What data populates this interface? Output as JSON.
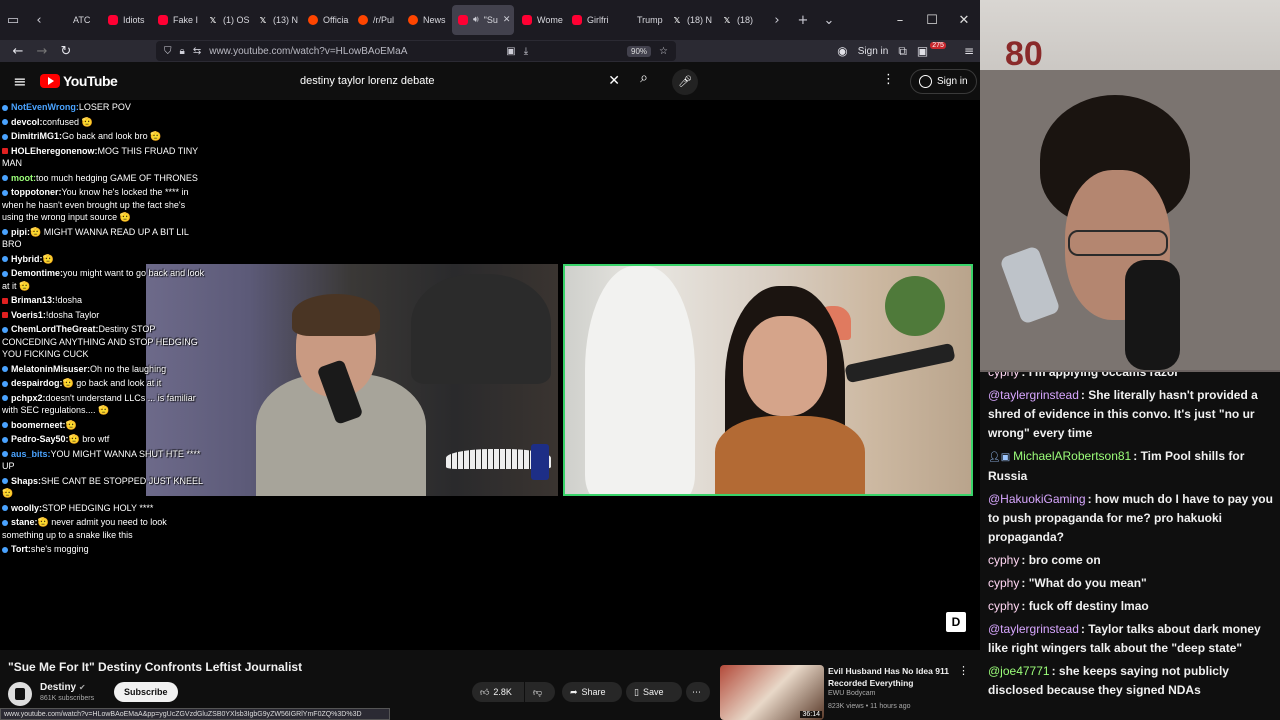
{
  "browser": {
    "tabs": [
      {
        "label": "ATC",
        "fav": "none"
      },
      {
        "label": "Idiots",
        "fav": "yt"
      },
      {
        "label": "Fake I",
        "fav": "yt"
      },
      {
        "label": "(1) OS",
        "fav": "x"
      },
      {
        "label": "(13) N",
        "fav": "x"
      },
      {
        "label": "Officia",
        "fav": "reddit"
      },
      {
        "label": "/r/Pul",
        "fav": "reddit"
      },
      {
        "label": "News",
        "fav": "reddit"
      },
      {
        "label": "\"Su",
        "fav": "yt",
        "active": true
      },
      {
        "label": "Wome",
        "fav": "yt"
      },
      {
        "label": "Girlfri",
        "fav": "yt"
      },
      {
        "label": "Trump",
        "fav": "none"
      },
      {
        "label": "(18) N",
        "fav": "x"
      },
      {
        "label": "(18)",
        "fav": "x"
      }
    ],
    "url": "www.youtube.com/watch?v=HLowBAoEMaA",
    "zoom": "90%",
    "sign_in": "Sign in",
    "badge_count": "275",
    "status_url": "www.youtube.com/watch?v=HLowBAoEMaA&pp=ygUcZGVzdGluZSB0YXlsb3IgbG9yZW56IGRlYmF0ZQ%3D%3D"
  },
  "youtube": {
    "logo_text": "YouTube",
    "search_query": "destiny taylor lorenz debate",
    "sign_in": "Sign in"
  },
  "overlay_chat": [
    {
      "user": "NotEvenWrong:",
      "msg": "LOSER POV",
      "dot": "blue",
      "ucolor": "#4aa3ff"
    },
    {
      "user": "devcol:",
      "msg": "confused 🫡",
      "dot": "blue",
      "ucolor": "#ffffff"
    },
    {
      "user": "DimitriMG1:",
      "msg": "Go back and look bro 🫡",
      "dot": "blue",
      "ucolor": "#ffffff"
    },
    {
      "user": "HOLEheregonenow:",
      "msg": "MOG THIS FRUAD TINY MAN",
      "dot": "red",
      "ucolor": "#ffffff"
    },
    {
      "user": "moot:",
      "msg": "too much hedging GAME OF THRONES",
      "dot": "blue",
      "ucolor": "#9cff7a"
    },
    {
      "user": "toppotoner:",
      "msg": "You know he's locked the **** in when he hasn't even brought up the fact she's using the wrong input source 🫡",
      "dot": "blue",
      "ucolor": "#ffffff"
    },
    {
      "user": "pipi:",
      "msg": "🫡 MIGHT WANNA READ UP A BIT LIL BRO",
      "dot": "blue",
      "ucolor": "#ffffff"
    },
    {
      "user": "Hybrid:",
      "msg": "🫡",
      "dot": "blue",
      "ucolor": "#ffffff"
    },
    {
      "user": "Demontime:",
      "msg": "you might want to go back and look at it 🫡",
      "dot": "blue",
      "ucolor": "#ffffff"
    },
    {
      "user": "Briman13:",
      "msg": "!dosha",
      "dot": "red",
      "ucolor": "#ffffff"
    },
    {
      "user": "Voeris1:",
      "msg": "!dosha Taylor",
      "dot": "red",
      "ucolor": "#ffffff"
    },
    {
      "user": "ChemLordTheGreat:",
      "msg": "Destiny STOP CONCEDING ANYTHING AND STOP HEDGING YOU FICKING CUCK",
      "dot": "blue",
      "ucolor": "#ffffff"
    },
    {
      "user": "MelatoninMisuser:",
      "msg": "Oh no the laughing",
      "dot": "blue",
      "ucolor": "#ffffff"
    },
    {
      "user": "despairdog:",
      "msg": "🫡 go back and look at it",
      "dot": "blue",
      "ucolor": "#ffffff"
    },
    {
      "user": "pchpx2:",
      "msg": "doesn't understand LLCs ... is familiar with SEC regulations.... 🫡",
      "dot": "blue",
      "ucolor": "#ffffff"
    },
    {
      "user": "boomerneet:",
      "msg": "🫡",
      "dot": "blue",
      "ucolor": "#ffffff"
    },
    {
      "user": "Pedro-Say50:",
      "msg": "🫡 bro wtf",
      "dot": "blue",
      "ucolor": "#ffffff"
    },
    {
      "user": "aus_bits:",
      "msg": "YOU MIGHT WANNA SHUT HTE **** UP",
      "dot": "blue",
      "ucolor": "#4aa3ff"
    },
    {
      "user": "Shaps:",
      "msg": "SHE CANT BE STOPPED JUST KNEEL 🫡",
      "dot": "blue",
      "ucolor": "#ffffff"
    },
    {
      "user": "woolly:",
      "msg": "STOP HEDGING HOLY ****",
      "dot": "blue",
      "ucolor": "#ffffff"
    },
    {
      "user": "stane:",
      "msg": "🫡 never admit you need to look something up to a snake like this",
      "dot": "blue",
      "ucolor": "#ffffff"
    },
    {
      "user": "Tort:",
      "msg": "she's mogging",
      "dot": "blue",
      "ucolor": "#ffffff"
    }
  ],
  "video_info": {
    "title": "\"Sue Me For It\" Destiny Confronts Leftist Journalist",
    "channel": "Destiny",
    "subscribers": "861K subscribers",
    "subscribe_label": "Subscribe",
    "likes": "2.8K",
    "share_label": "Share",
    "save_label": "Save"
  },
  "recommended": {
    "title": "Evil Husband Has No Idea 911 Recorded Everything",
    "channel": "EWU Bodycam",
    "meta": "823K views • 11 hours ago",
    "duration": "36:14"
  },
  "webcam": {
    "wall_number": "80"
  },
  "side_chat": [
    {
      "user": "cyphy",
      "msg": ": I'm applying occams razor",
      "cls": "plain"
    },
    {
      "user": "@taylergrinstead",
      "msg": ": She literally hasn't provided a shred of evidence in this convo. It's just \"no ur wrong\" every time",
      "cls": "at"
    },
    {
      "user": "MichaelARobertson81",
      "msg": ": Tim Pool shills for Russia",
      "cls": "green",
      "badge": "👤"
    },
    {
      "user": "@HakuokiGaming",
      "msg": ": how much do I have to pay you to push propaganda for me? pro hakuoki propaganda?",
      "cls": "at"
    },
    {
      "user": "cyphy",
      "msg": ": bro come on",
      "cls": "plain"
    },
    {
      "user": "cyphy",
      "msg": ": \"What do you mean\"",
      "cls": "plain"
    },
    {
      "user": "cyphy",
      "msg": ": fuck off destiny lmao",
      "cls": "plain"
    },
    {
      "user": "@taylergrinstead",
      "msg": ": Taylor talks about dark money like right wingers talk about the \"deep state\"",
      "cls": "at"
    },
    {
      "user": "@joe47771",
      "msg": ": she keeps saying not publicly disclosed because they signed NDAs",
      "cls": "green"
    }
  ]
}
